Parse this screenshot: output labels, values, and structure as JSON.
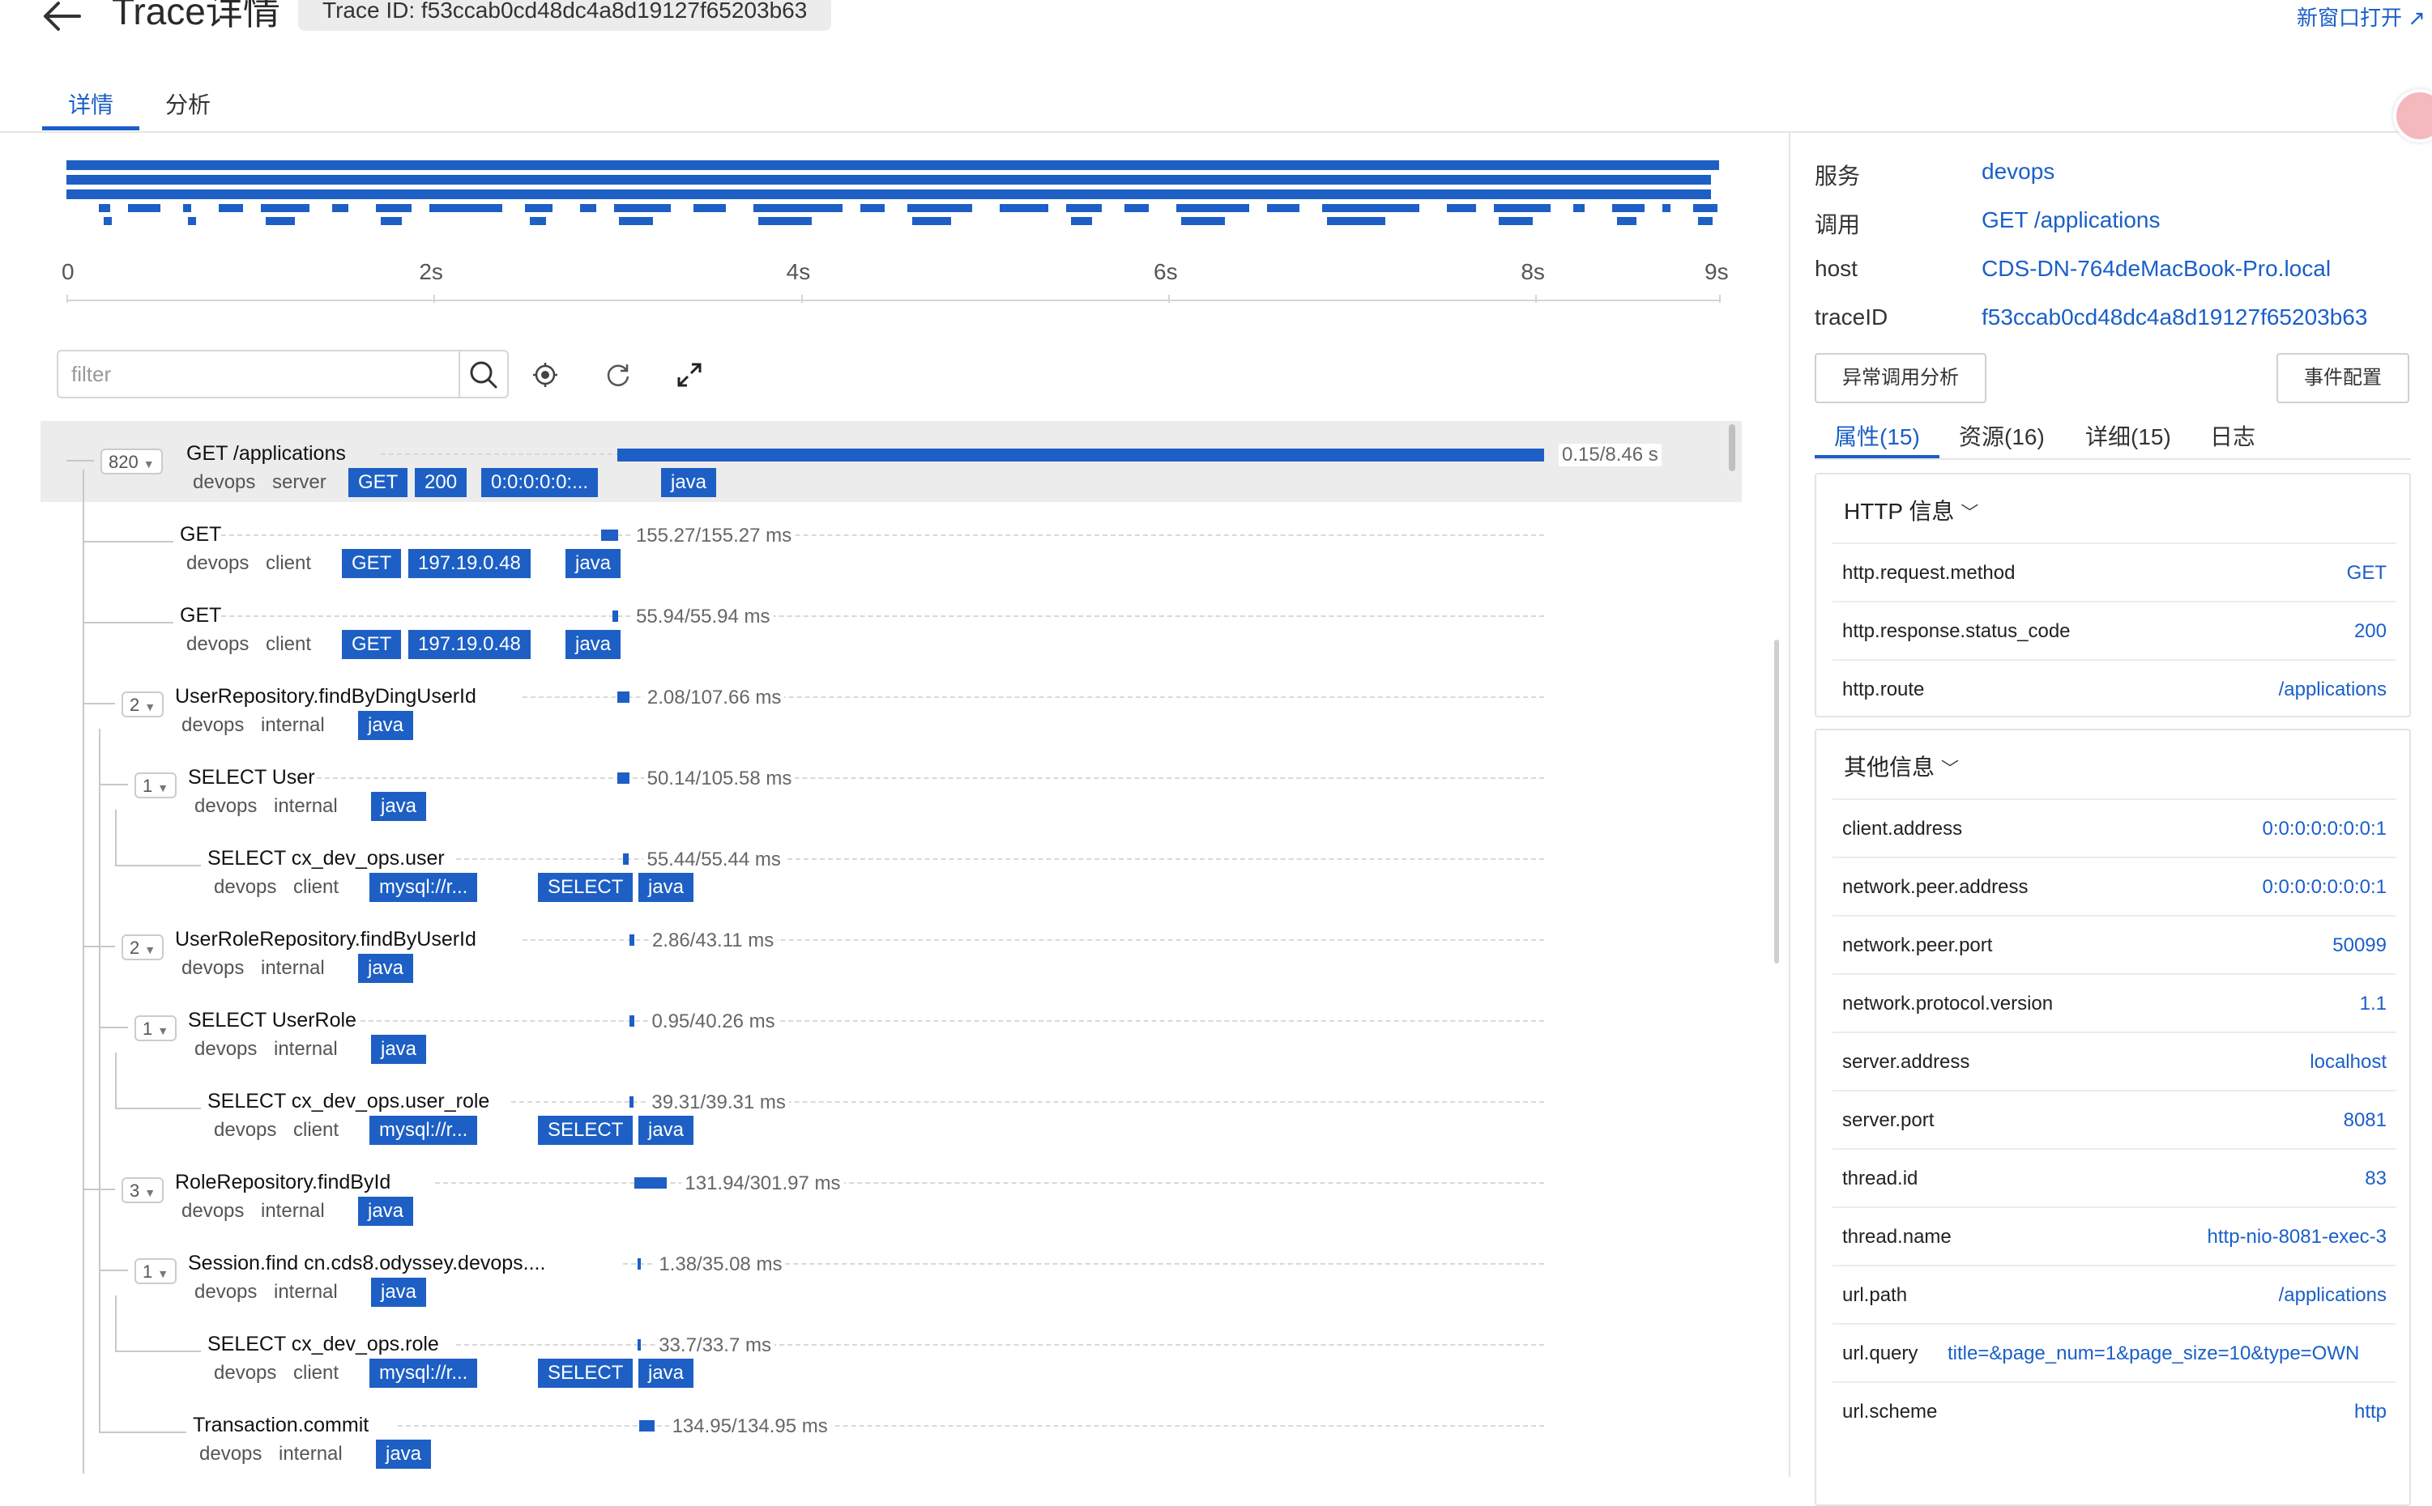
{
  "header": {
    "title": "Trace详情",
    "trace_id_label": "Trace ID: f53ccab0cd48dc4a8d19127f65203b63",
    "new_window": "新窗口打开"
  },
  "tabs": [
    "详情",
    "分析"
  ],
  "timeline": {
    "ticks": [
      "0",
      "2s",
      "4s",
      "6s",
      "8s",
      "9s"
    ],
    "total_seconds": 9
  },
  "toolbar": {
    "filter_placeholder": "filter"
  },
  "spans": [
    {
      "name": "GET /applications",
      "service": "devops",
      "kind": "server",
      "tags": [
        "GET",
        "200",
        "0:0:0:0:0:...",
        "java"
      ],
      "duration": "0.15/8.46 s",
      "count": "820",
      "start_s": 0.15,
      "dur_s": 8.46
    },
    {
      "name": "GET",
      "service": "devops",
      "kind": "client",
      "tags": [
        "GET",
        "197.19.0.48",
        "java"
      ],
      "duration": "155.27/155.27 ms",
      "count": "",
      "start_s": 0.0,
      "dur_s": 0.155
    },
    {
      "name": "GET",
      "service": "devops",
      "kind": "client",
      "tags": [
        "GET",
        "197.19.0.48",
        "java"
      ],
      "duration": "55.94/55.94 ms",
      "count": "",
      "start_s": 0.1,
      "dur_s": 0.056
    },
    {
      "name": "UserRepository.findByDingUserId",
      "service": "devops",
      "kind": "internal",
      "tags": [
        "java"
      ],
      "duration": "2.08/107.66 ms",
      "count": "2",
      "start_s": 0.15,
      "dur_s": 0.108
    },
    {
      "name": "SELECT User",
      "service": "devops",
      "kind": "internal",
      "tags": [
        "java"
      ],
      "duration": "50.14/105.58 ms",
      "count": "1",
      "start_s": 0.15,
      "dur_s": 0.106
    },
    {
      "name": "SELECT cx_dev_ops.user",
      "service": "devops",
      "kind": "client",
      "tags": [
        "mysql://r...",
        "SELECT",
        "java"
      ],
      "duration": "55.44/55.44 ms",
      "count": "",
      "start_s": 0.2,
      "dur_s": 0.055
    },
    {
      "name": "UserRoleRepository.findByUserId",
      "service": "devops",
      "kind": "internal",
      "tags": [
        "java"
      ],
      "duration": "2.86/43.11 ms",
      "count": "2",
      "start_s": 0.26,
      "dur_s": 0.043
    },
    {
      "name": "SELECT UserRole",
      "service": "devops",
      "kind": "internal",
      "tags": [
        "java"
      ],
      "duration": "0.95/40.26 ms",
      "count": "1",
      "start_s": 0.26,
      "dur_s": 0.04
    },
    {
      "name": "SELECT cx_dev_ops.user_role",
      "service": "devops",
      "kind": "client",
      "tags": [
        "mysql://r...",
        "SELECT",
        "java"
      ],
      "duration": "39.31/39.31 ms",
      "count": "",
      "start_s": 0.26,
      "dur_s": 0.039
    },
    {
      "name": "RoleRepository.findById",
      "service": "devops",
      "kind": "internal",
      "tags": [
        "java"
      ],
      "duration": "131.94/301.97 ms",
      "count": "3",
      "start_s": 0.3,
      "dur_s": 0.302
    },
    {
      "name": "Session.find cn.cds8.odyssey.devops....",
      "service": "devops",
      "kind": "internal",
      "tags": [
        "java"
      ],
      "duration": "1.38/35.08 ms",
      "count": "1",
      "start_s": 0.33,
      "dur_s": 0.035
    },
    {
      "name": "SELECT cx_dev_ops.role",
      "service": "devops",
      "kind": "client",
      "tags": [
        "mysql://r...",
        "SELECT",
        "java"
      ],
      "duration": "33.7/33.7 ms",
      "count": "",
      "start_s": 0.33,
      "dur_s": 0.034
    },
    {
      "name": "Transaction.commit",
      "service": "devops",
      "kind": "internal",
      "tags": [
        "java"
      ],
      "duration": "134.95/134.95 ms",
      "count": "",
      "start_s": 0.35,
      "dur_s": 0.135
    }
  ],
  "detail": {
    "summary": [
      {
        "key": "服务",
        "value": "devops"
      },
      {
        "key": "调用",
        "value": "GET /applications"
      },
      {
        "key": "host",
        "value": "CDS-DN-764deMacBook-Pro.local"
      },
      {
        "key": "traceID",
        "value": "f53ccab0cd48dc4a8d19127f65203b63"
      }
    ],
    "buttons": {
      "anomaly": "异常调用分析",
      "event": "事件配置"
    },
    "tabs": [
      "属性(15)",
      "资源(16)",
      "详细(15)",
      "日志"
    ],
    "http_title": "HTTP 信息",
    "http": [
      {
        "key": "http.request.method",
        "value": "GET"
      },
      {
        "key": "http.response.status_code",
        "value": "200"
      },
      {
        "key": "http.route",
        "value": "/applications"
      }
    ],
    "other_title": "其他信息",
    "other": [
      {
        "key": "client.address",
        "value": "0:0:0:0:0:0:0:1"
      },
      {
        "key": "network.peer.address",
        "value": "0:0:0:0:0:0:0:1"
      },
      {
        "key": "network.peer.port",
        "value": "50099"
      },
      {
        "key": "network.protocol.version",
        "value": "1.1"
      },
      {
        "key": "server.address",
        "value": "localhost"
      },
      {
        "key": "server.port",
        "value": "8081"
      },
      {
        "key": "thread.id",
        "value": "83"
      },
      {
        "key": "thread.name",
        "value": "http-nio-8081-exec-3"
      },
      {
        "key": "url.path",
        "value": "/applications"
      },
      {
        "key": "url.query",
        "value": "title=&page_num=1&page_size=10&type=OWN"
      },
      {
        "key": "url.scheme",
        "value": "http"
      }
    ]
  },
  "colors": {
    "accent": "#1a5fc8",
    "bar": "#1d5fc4"
  }
}
